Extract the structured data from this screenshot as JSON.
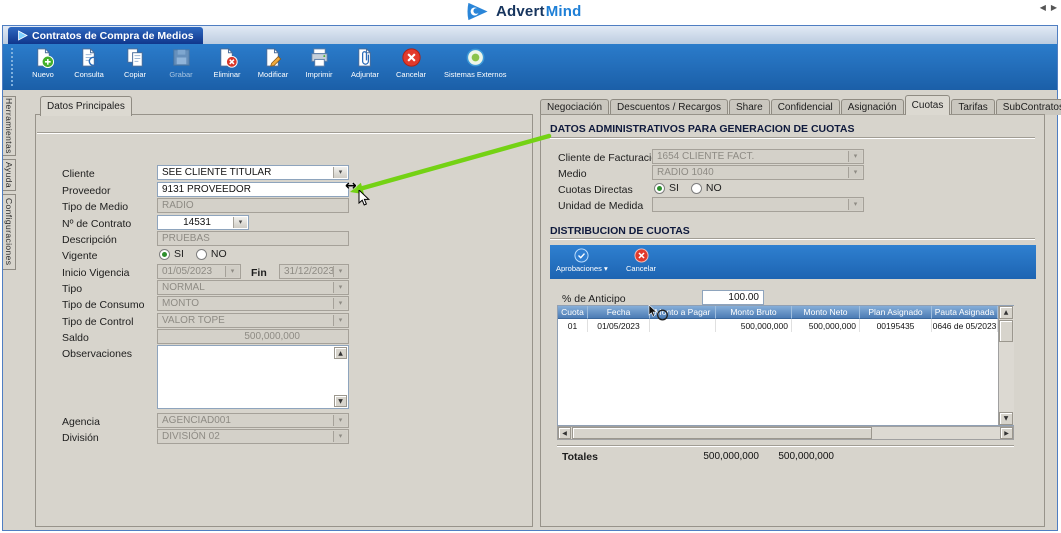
{
  "topbar": {
    "brand_primary": "Advert",
    "brand_secondary": "Mind"
  },
  "window": {
    "title": "Contratos de Compra de Medios"
  },
  "icons": {
    "combo_caret": "▾",
    "dropdown_caret": "▾",
    "scroll_up": "▲",
    "scroll_down": "▼",
    "scroll_left": "◀",
    "scroll_right": "▶",
    "tab_prev": "◀",
    "tab_next": "▶",
    "resize_horizontal": "↔"
  },
  "colors": {
    "toolbar_blue": "#1f6fc0",
    "title_tab_blue": "#17439e",
    "grid_header_blue": "#5d8cc0",
    "annotation_green": "#74d214",
    "brand_navy": "#17355e",
    "brand_blue": "#1e7fd6",
    "cancel_red": "#e23a2c",
    "new_green": "#43b02a"
  },
  "toolbar": {
    "items": [
      {
        "label": "Nuevo"
      },
      {
        "label": "Consulta"
      },
      {
        "label": "Copiar"
      },
      {
        "label": "Grabar"
      },
      {
        "label": "Eliminar"
      },
      {
        "label": "Modificar"
      },
      {
        "label": "Imprimir"
      },
      {
        "label": "Adjuntar"
      },
      {
        "label": "Cancelar"
      },
      {
        "label": "Sistemas Externos"
      }
    ]
  },
  "side_tabs": {
    "items": [
      {
        "label": "Herramientas"
      },
      {
        "label": "Ayuda"
      },
      {
        "label": "Configuraciones"
      }
    ]
  },
  "left_panel": {
    "tab_label": "Datos Principales",
    "cliente_label": "Cliente",
    "cliente_value": "SEE CLIENTE TITULAR",
    "proveedor_label": "Proveedor",
    "proveedor_value": "9131 PROVEEDOR",
    "tipo_medio_label": "Tipo de Medio",
    "tipo_medio_value": "RADIO",
    "contrato_label": "Nº de Contrato",
    "contrato_value": "14531",
    "descripcion_label": "Descripción",
    "descripcion_value": "PRUEBAS",
    "vigente_label": "Vigente",
    "vigente_si": "SI",
    "vigente_no": "NO",
    "inicio_label": "Inicio Vigencia",
    "inicio_value": "01/05/2023",
    "fin_label": "Fin",
    "fin_value": "31/12/2023",
    "tipo_label": "Tipo",
    "tipo_value": "NORMAL",
    "consumo_label": "Tipo de Consumo",
    "consumo_value": "MONTO",
    "control_label": "Tipo de Control",
    "control_value": "VALOR TOPE",
    "saldo_label": "Saldo",
    "saldo_value": "500,000,000",
    "observaciones_label": "Observaciones",
    "observaciones_value": "",
    "agencia_label": "Agencia",
    "agencia_value": "AGENCIAD001",
    "division_label": "División",
    "division_value": "DIVISIÓN 02"
  },
  "right_panel": {
    "tabs": [
      "Negociación",
      "Descuentos / Recargos",
      "Share",
      "Confidencial",
      "Asignación",
      "Cuotas",
      "Tarifas",
      "SubContratos"
    ],
    "active_tab": "Cuotas",
    "admin": {
      "title": "DATOS ADMINISTRATIVOS PARA GENERACION DE CUOTAS",
      "cliente_fact_label": "Cliente de Facturación",
      "cliente_fact_value": "1654 CLIENTE FACT.",
      "medio_label": "Medio",
      "medio_value": "RADIO 1040",
      "cuotas_directas_label": "Cuotas Directas",
      "cuotas_si": "SI",
      "cuotas_no": "NO",
      "unidad_label": "Unidad de Medida",
      "unidad_value": ""
    },
    "dist": {
      "title": "DISTRIBUCION DE CUOTAS",
      "aprobaciones_label": "Aprobaciones",
      "cancelar_label": "Cancelar",
      "anticipo_label": "% de Anticipo",
      "anticipo_value": "100.00",
      "grid": {
        "columns": [
          "Cuota",
          "Fecha",
          "Monto a Pagar",
          "Monto Bruto",
          "Monto Neto",
          "Plan Asignado",
          "Pauta Asignada"
        ],
        "rows": [
          [
            "01",
            "01/05/2023",
            "",
            "500,000,000",
            "500,000,000",
            "00195435",
            "0646 de 05/2023"
          ]
        ]
      },
      "totales_label": "Totales",
      "total_monto_bruto": "500,000,000",
      "total_monto_neto": "500,000,000"
    }
  }
}
